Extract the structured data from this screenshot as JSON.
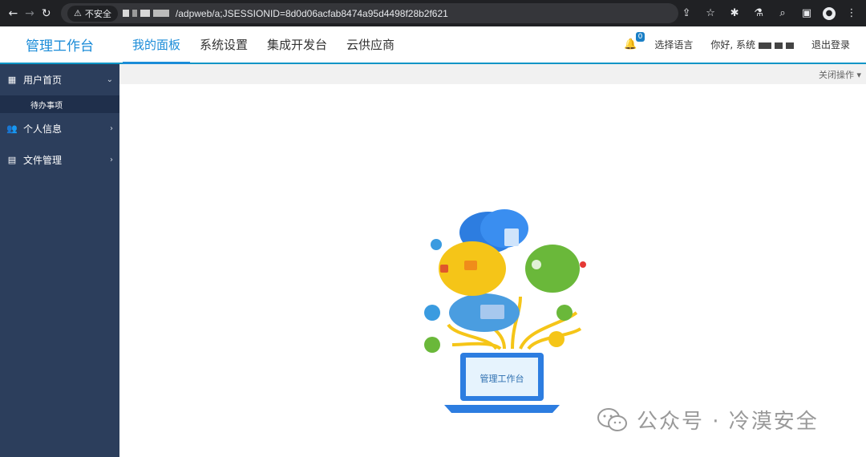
{
  "browser": {
    "security_label": "不安全",
    "url": "/adpweb/a;JSESSIONID=8d0d06acfab8474a95d4498f28b2f621"
  },
  "header": {
    "brand": "管理工作台",
    "tabs": [
      {
        "label": "我的面板",
        "active": true
      },
      {
        "label": "系统设置"
      },
      {
        "label": "集成开发台"
      },
      {
        "label": "云供应商"
      }
    ],
    "notification_count": "0",
    "language": "选择语言",
    "greeting": "你好, 系统",
    "logout": "退出登录"
  },
  "sidebar": {
    "items": [
      {
        "label": "用户首页",
        "icon": "calendar-icon",
        "expanded": true
      },
      {
        "label": "个人信息",
        "icon": "users-icon"
      },
      {
        "label": "文件管理",
        "icon": "file-icon"
      }
    ],
    "sub_item": "待办事项"
  },
  "tabbar": {
    "close_ops": "关闭操作"
  },
  "illustration": {
    "laptop_text": "管理工作台"
  },
  "watermark": {
    "text": "公众号 · 冷漠安全"
  },
  "colors": {
    "accent": "#1b8cd8",
    "sidebar": "#2c3e5c",
    "chrome": "#202124"
  }
}
